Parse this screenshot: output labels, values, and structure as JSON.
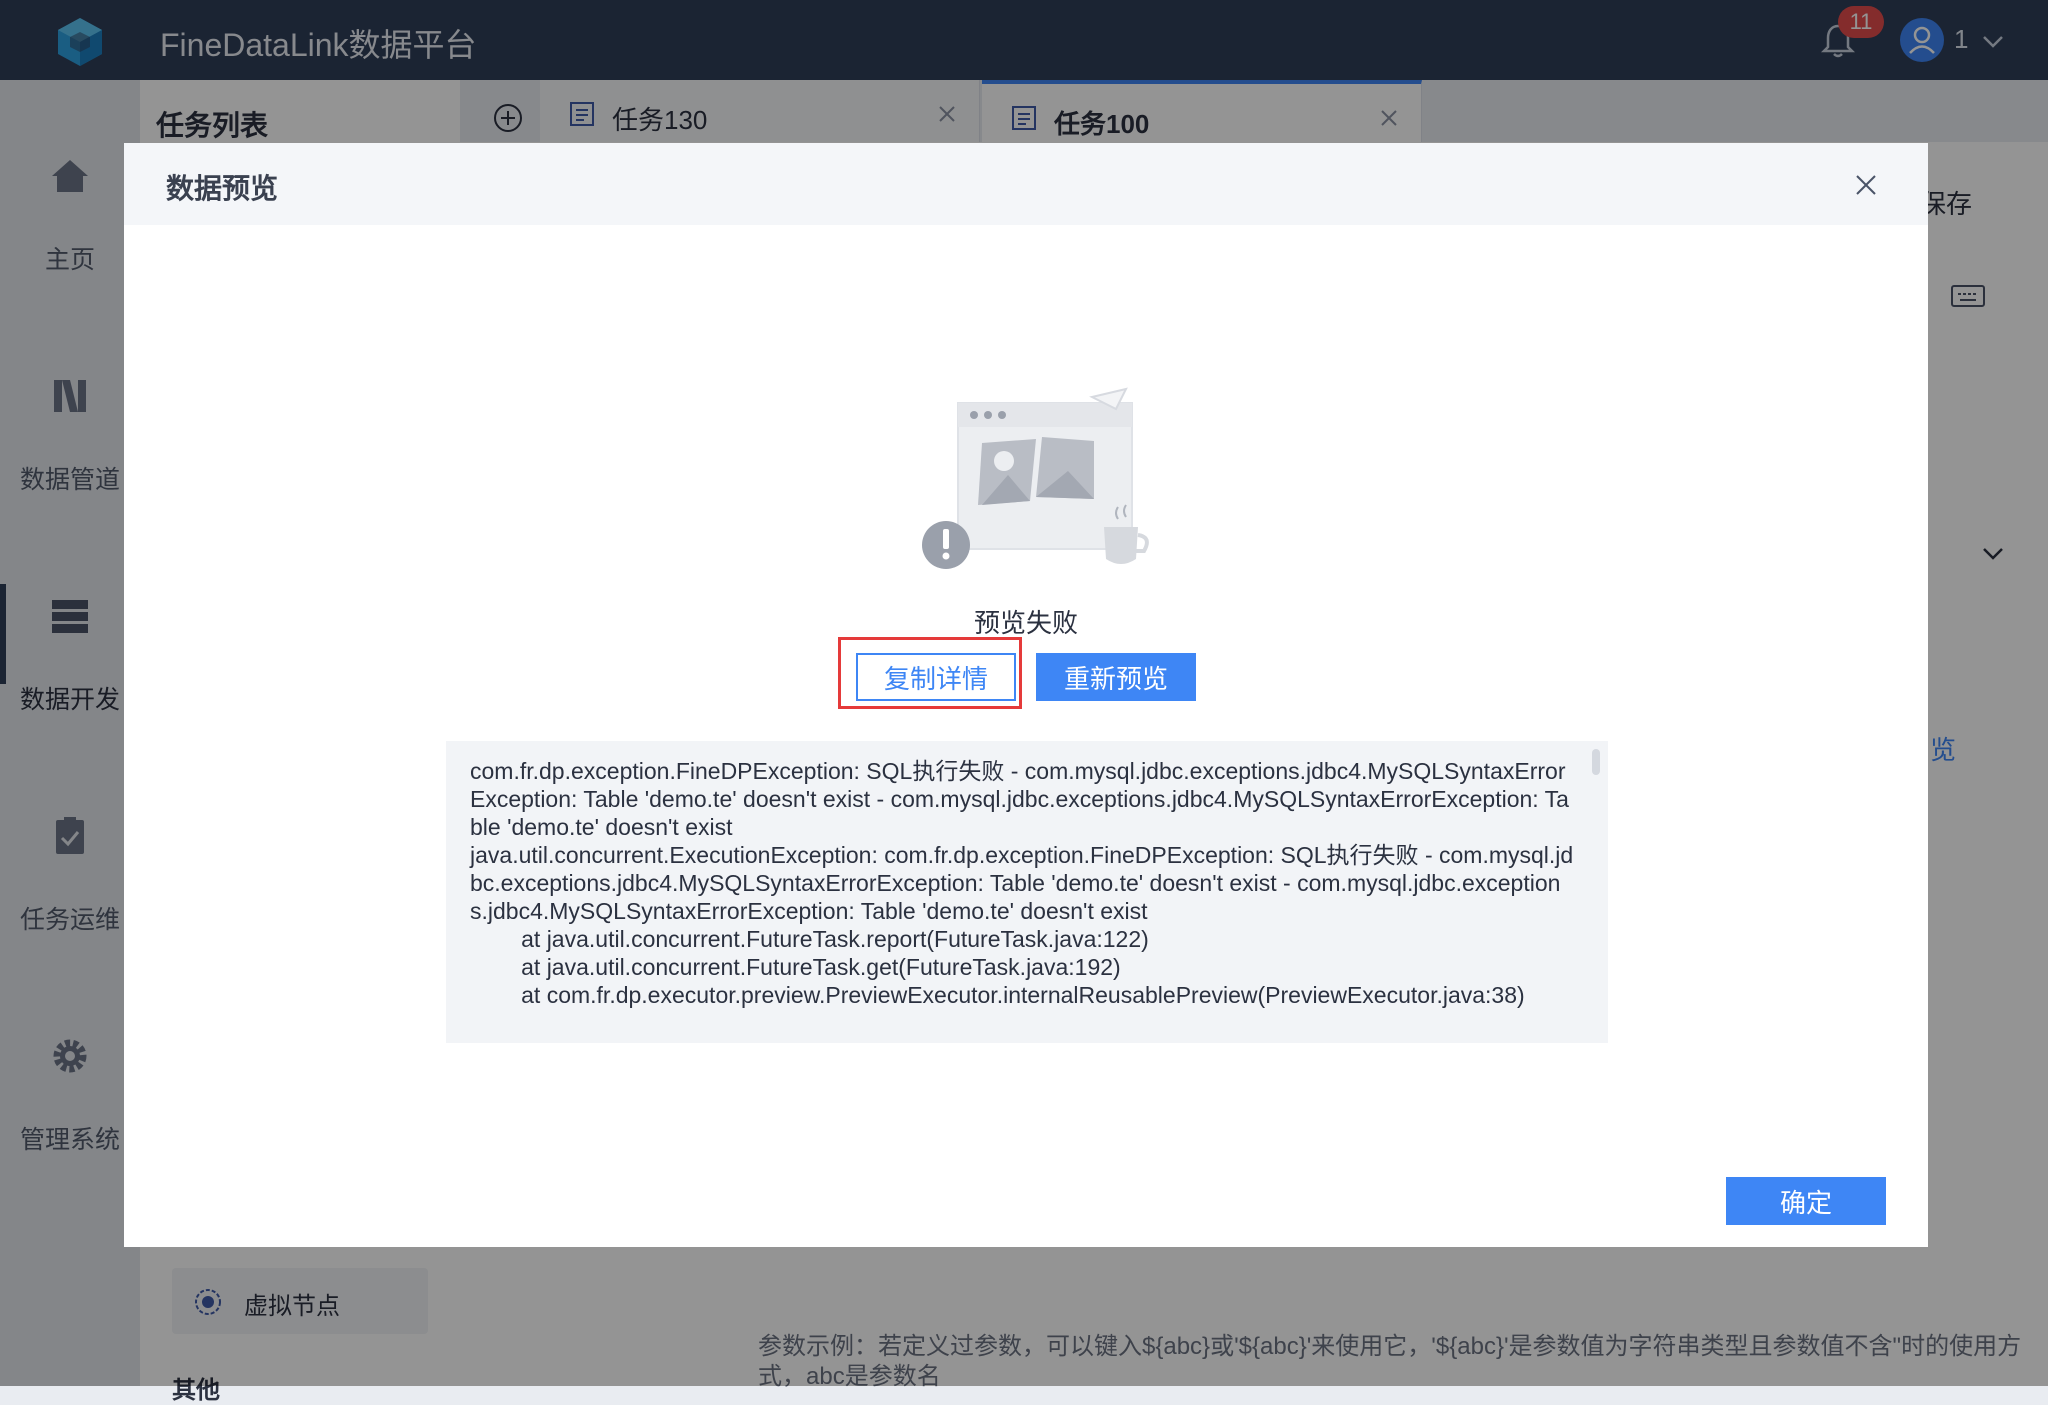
{
  "app": {
    "title": "FineDataLink数据平台",
    "notification_count": "11",
    "user_name": "1"
  },
  "sidebar": {
    "items": [
      {
        "label": "主页",
        "icon": "home-icon"
      },
      {
        "label": "数据管道",
        "icon": "pipeline-icon"
      },
      {
        "label": "数据开发",
        "icon": "dev-icon"
      },
      {
        "label": "任务运维",
        "icon": "ops-icon"
      },
      {
        "label": "管理系统",
        "icon": "gear-icon"
      }
    ]
  },
  "task_panel": {
    "title": "任务列表",
    "virtual_node_label": "虚拟节点",
    "other_label": "其他"
  },
  "tabs": [
    {
      "label": "任务130"
    },
    {
      "label": "任务100"
    }
  ],
  "workspace": {
    "save_label": "保存",
    "preview_link": "览",
    "hint": "参数示例：若定义过参数，可以键入${abc}或'${abc}'来使用它，'${abc}'是参数值为字符串类型且参数值不含\"时的使用方式，abc是参数名"
  },
  "modal": {
    "title": "数据预览",
    "status_text": "预览失败",
    "copy_button": "复制详情",
    "repreview_button": "重新预览",
    "ok_button": "确定",
    "error_detail": "com.fr.dp.exception.FineDPException: SQL执行失败 - com.mysql.jdbc.exceptions.jdbc4.MySQLSyntaxErrorException: Table 'demo.te' doesn't exist - com.mysql.jdbc.exceptions.jdbc4.MySQLSyntaxErrorException: Table 'demo.te' doesn't exist\njava.util.concurrent.ExecutionException: com.fr.dp.exception.FineDPException: SQL执行失败 - com.mysql.jdbc.exceptions.jdbc4.MySQLSyntaxErrorException: Table 'demo.te' doesn't exist - com.mysql.jdbc.exceptions.jdbc4.MySQLSyntaxErrorException: Table 'demo.te' doesn't exist\n\tat java.util.concurrent.FutureTask.report(FutureTask.java:122)\n\tat java.util.concurrent.FutureTask.get(FutureTask.java:192)\n\tat com.fr.dp.executor.preview.PreviewExecutor.internalReusablePreview(PreviewExecutor.java:38)"
  },
  "colors": {
    "topbar": "#2f3e58",
    "accent": "#3e86f5",
    "highlight": "#e53a3a",
    "badge": "#e34d4d"
  }
}
